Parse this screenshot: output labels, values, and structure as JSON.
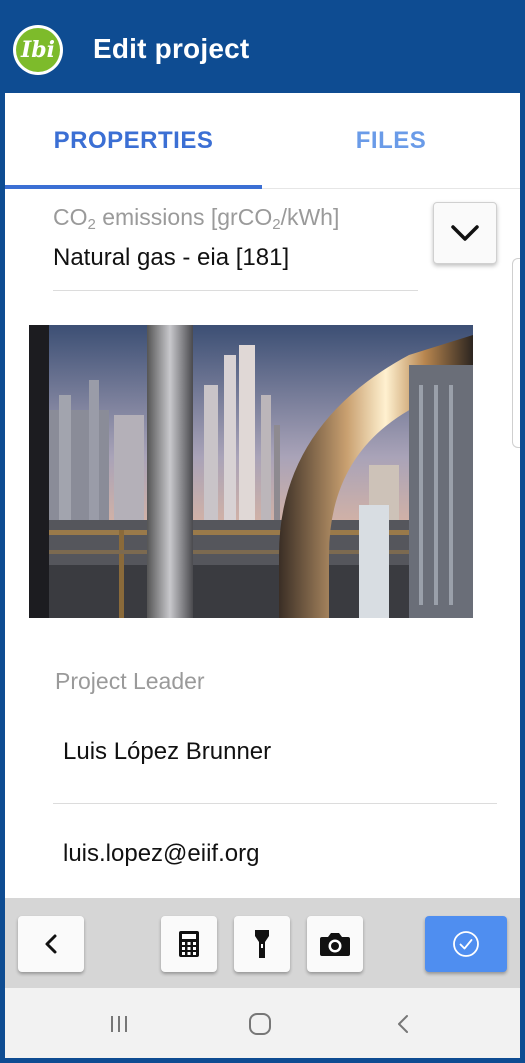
{
  "appbar": {
    "logo_text": "Ibi",
    "title": "Edit project"
  },
  "tabs": [
    {
      "label": "PROPERTIES",
      "selected": true
    },
    {
      "label": "FILES",
      "selected": false
    }
  ],
  "co2_field": {
    "label_prefix": "CO",
    "label_sub1": "2",
    "label_middle": " emissions [grCO",
    "label_sub2": "2",
    "label_suffix": "/kWh]",
    "value": "Natural gas - eia [181]"
  },
  "photo": {
    "description_icon": "industrial-plant-photo"
  },
  "project_leader": {
    "label": "Project Leader",
    "name": "Luis López Brunner",
    "email": "luis.lopez@eiif.org"
  },
  "toolbar": {
    "back_icon": "chevron-left-icon",
    "calculator_icon": "calculator-icon",
    "flashlight_icon": "flashlight-icon",
    "camera_icon": "camera-icon",
    "confirm_icon": "check-circle-icon"
  },
  "navbar": {
    "recents_icon": "recents-icon",
    "home_icon": "home-icon",
    "back_icon": "back-icon"
  },
  "colors": {
    "brand_blue": "#0e4c92",
    "tab_active": "#3b6fd4",
    "confirm_button": "#4f8ef0",
    "logo_green": "#7dbb2b"
  }
}
